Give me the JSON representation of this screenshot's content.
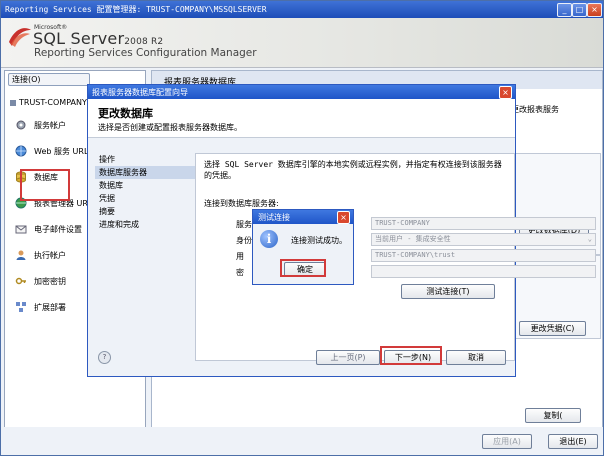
{
  "window": {
    "title": "Reporting Services 配置管理器: TRUST-COMPANY\\MSSQLSERVER",
    "minimize": "_",
    "maximize": "□",
    "close": "×"
  },
  "brand": {
    "microsoft": "Microsoft®",
    "product": "SQL Server",
    "version": "2008 R2",
    "subtitle": "Reporting Services Configuration Manager"
  },
  "nav": {
    "connect_label": "连接(O)",
    "server": "TRUST-COMPANY\\MS",
    "items": [
      {
        "label": "服务帐户"
      },
      {
        "label": "Web 服务 URL"
      },
      {
        "label": "数据库"
      },
      {
        "label": "报表管理器 URL"
      },
      {
        "label": "电子邮件设置"
      },
      {
        "label": "执行帐户"
      },
      {
        "label": "加密密钥"
      },
      {
        "label": "扩展部署"
      }
    ]
  },
  "content": {
    "header": "报表服务器数据库",
    "right_text": "更改报表服务",
    "change_db_button": "更改数据库(D)",
    "change_cred_button": "更改凭据(C)",
    "copy_button": "复制(",
    "apply_button": "应用(A)",
    "exit_button": "退出(E)"
  },
  "wizard": {
    "title": "报表服务器数据库配置向导",
    "close": "×",
    "heading": "更改数据库",
    "subheading": "选择是否创建或配置报表服务器数据库。",
    "steps": [
      {
        "label": "操作",
        "active": false
      },
      {
        "label": "数据库服务器",
        "active": true
      },
      {
        "label": "数据库",
        "active": false
      },
      {
        "label": "凭据",
        "active": false
      },
      {
        "label": "摘要",
        "active": false
      },
      {
        "label": "进度和完成",
        "active": false
      }
    ],
    "description": "选择 SQL Server 数据库引擎的本地实例或远程实例，并指定有权连接到该服务器的凭据。",
    "conn_label": "连接到数据库服务器:",
    "fields": [
      {
        "label": "服务",
        "value": "TRUST-COMPANY"
      },
      {
        "label": "身份",
        "value": "当前用户 - 集成安全性"
      },
      {
        "label": "用",
        "value": "TRUST-COMPANY\\trust"
      },
      {
        "label": "密",
        "value": ""
      }
    ],
    "test_button": "测试连接(T)",
    "help_icon": "?",
    "prev_button": "上一页(P)",
    "next_button": "下一步(N)",
    "cancel_button": "取消"
  },
  "test_dialog": {
    "title": "测试连接",
    "close": "×",
    "icon": "i",
    "message": "连接测试成功。",
    "ok_button": "确定"
  }
}
